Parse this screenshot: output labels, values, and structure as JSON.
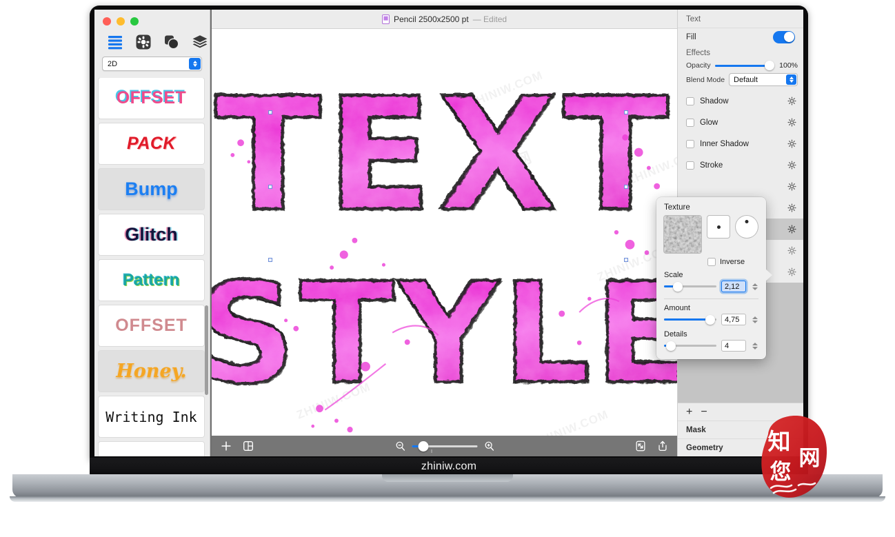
{
  "brand": {
    "chin_text": "zhiniw.com"
  },
  "window": {
    "title": "Pencil 2500x2500 pt",
    "title_status": "— Edited"
  },
  "sidebar": {
    "tools": [
      {
        "name": "list-icon",
        "label": "List"
      },
      {
        "name": "gear-icon",
        "label": "Settings"
      },
      {
        "name": "shapes-icon",
        "label": "Shapes"
      },
      {
        "name": "layers-icon",
        "label": "Layers"
      }
    ],
    "mode_select": {
      "value": "2D"
    },
    "presets": [
      {
        "label": "OFFSET",
        "style": "lbl-offset1",
        "selected": false
      },
      {
        "label": "PACK",
        "style": "lbl-pack",
        "selected": false
      },
      {
        "label": "Bump",
        "style": "lbl-bump",
        "selected": true
      },
      {
        "label": "Glitch",
        "style": "lbl-glitch",
        "selected": false
      },
      {
        "label": "Pattern",
        "style": "lbl-pattern",
        "selected": false
      },
      {
        "label": "OFFSET",
        "style": "lbl-offset2",
        "selected": false
      },
      {
        "label": "Honey.",
        "style": "lbl-honey",
        "selected": true
      },
      {
        "label": "Writing Ink",
        "style": "lbl-writing",
        "selected": false
      }
    ]
  },
  "canvas": {
    "artwork_line1": "TEXT",
    "artwork_line2": "STYLE",
    "artwork_color": "#ec3fd8",
    "watermarks": [
      "ZHINIW.COM",
      "ZHINIW.COM",
      "ZHINIW.COM",
      "ZHINIW.COM",
      "ZHINIW.COM"
    ],
    "watermark_cjk": "知您网"
  },
  "bottombar": {
    "add_label": "+",
    "layout_icon": "layout-grid-icon",
    "zoom_out_icon": "zoom-out-icon",
    "zoom_in_icon": "zoom-in-icon",
    "fit_icon": "fit-screen-icon",
    "export_icon": "export-icon"
  },
  "right_panel": {
    "header": "Text",
    "fill": {
      "label": "Fill",
      "enabled": true
    },
    "effects_label": "Effects",
    "opacity": {
      "label": "Opacity",
      "value": "100%",
      "percent": 100
    },
    "blend_mode": {
      "label": "Blend Mode",
      "value": "Default"
    },
    "effects": [
      {
        "label": "Shadow",
        "checked": false,
        "highlight": false
      },
      {
        "label": "Glow",
        "checked": false,
        "highlight": false
      },
      {
        "label": "Inner Shadow",
        "checked": false,
        "highlight": false
      },
      {
        "label": "Stroke",
        "checked": false,
        "highlight": false
      },
      {
        "label": "",
        "checked": false,
        "highlight": false
      },
      {
        "label": "",
        "checked": false,
        "highlight": false
      },
      {
        "label": "",
        "checked": false,
        "highlight": true
      },
      {
        "label": "",
        "checked": false,
        "highlight": false
      },
      {
        "label": "",
        "checked": false,
        "highlight": false
      }
    ],
    "plus_label": "+",
    "minus_label": "−",
    "footer_rows": [
      "Mask",
      "Geometry"
    ]
  },
  "texture_popover": {
    "title": "Texture",
    "inverse": {
      "label": "Inverse",
      "checked": false
    },
    "scale": {
      "label": "Scale",
      "value": "2,12",
      "percent": 26,
      "focused": true
    },
    "amount": {
      "label": "Amount",
      "value": "4,75",
      "percent": 88
    },
    "details": {
      "label": "Details",
      "value": "4",
      "percent": 10
    }
  },
  "colors": {
    "accent": "#1577ef",
    "panel_bg": "#ececec",
    "toolbar_bg": "#767676",
    "artwork_pink": "#ec3fd8",
    "seal_red": "#c8191e"
  }
}
